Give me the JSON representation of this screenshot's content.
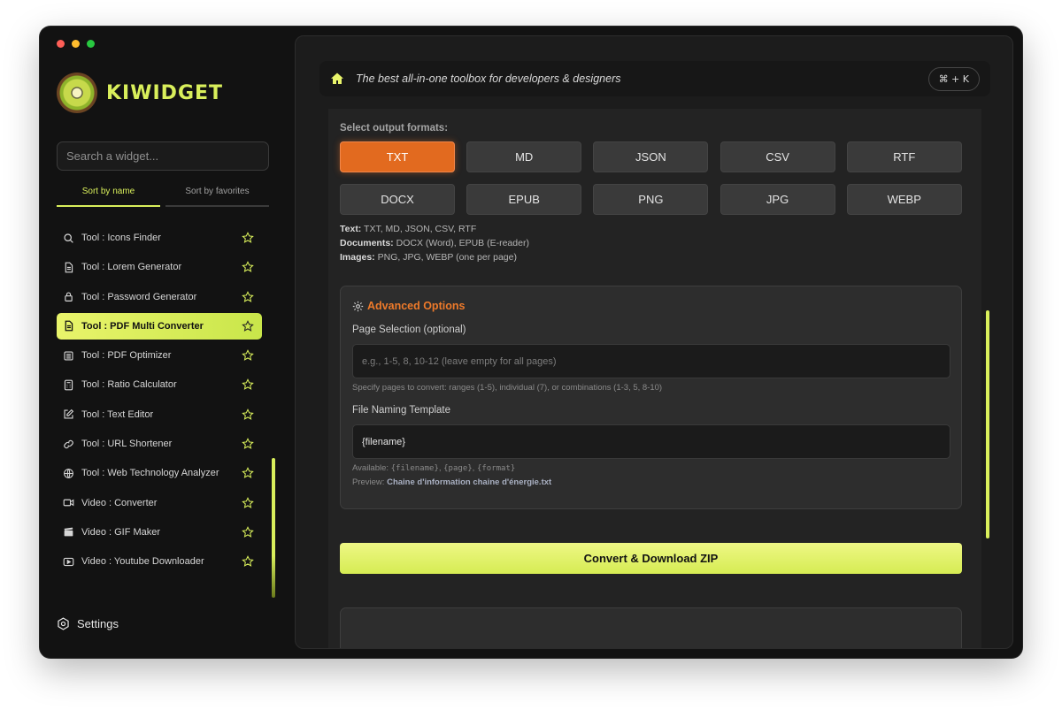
{
  "window": {
    "traffic_lights": [
      "close",
      "minimize",
      "zoom"
    ]
  },
  "brand": {
    "name": "KIWIDGET",
    "logo_icon": "kiwi-logo",
    "accent": "#d9ef5b"
  },
  "sidebar": {
    "search_placeholder": "Search a widget...",
    "sort_tabs": [
      {
        "label": "Sort by name",
        "active": true
      },
      {
        "label": "Sort by favorites",
        "active": false
      }
    ],
    "items": [
      {
        "label": "Tool : Icons Finder",
        "icon": "search-icon",
        "active": false
      },
      {
        "label": "Tool : Lorem Generator",
        "icon": "document-icon",
        "active": false
      },
      {
        "label": "Tool : Password Generator",
        "icon": "lock-icon",
        "active": false
      },
      {
        "label": "Tool : PDF Multi Converter",
        "icon": "file-text-icon",
        "active": true
      },
      {
        "label": "Tool : PDF Optimizer",
        "icon": "archive-icon",
        "active": false
      },
      {
        "label": "Tool : Ratio Calculator",
        "icon": "calculator-icon",
        "active": false
      },
      {
        "label": "Tool : Text Editor",
        "icon": "edit-icon",
        "active": false
      },
      {
        "label": "Tool : URL Shortener",
        "icon": "link-icon",
        "active": false
      },
      {
        "label": "Tool : Web Technology Analyzer",
        "icon": "globe-icon",
        "active": false
      },
      {
        "label": "Video : Converter",
        "icon": "video-icon",
        "active": false
      },
      {
        "label": "Video : GIF Maker",
        "icon": "clapperboard-icon",
        "active": false
      },
      {
        "label": "Video : Youtube Downloader",
        "icon": "play-icon",
        "active": false
      }
    ],
    "settings_label": "Settings"
  },
  "topbar": {
    "tagline": "The best all-in-one toolbox for developers & designers",
    "shortcut": "⌘ + K"
  },
  "formats": {
    "title": "Select output formats:",
    "buttons": [
      {
        "label": "TXT",
        "selected": true
      },
      {
        "label": "MD",
        "selected": false
      },
      {
        "label": "JSON",
        "selected": false
      },
      {
        "label": "CSV",
        "selected": false
      },
      {
        "label": "RTF",
        "selected": false
      },
      {
        "label": "DOCX",
        "selected": false
      },
      {
        "label": "EPUB",
        "selected": false
      },
      {
        "label": "PNG",
        "selected": false
      },
      {
        "label": "JPG",
        "selected": false
      },
      {
        "label": "WEBP",
        "selected": false
      }
    ],
    "info": [
      {
        "label": "Text:",
        "value": "TXT, MD, JSON, CSV, RTF"
      },
      {
        "label": "Documents:",
        "value": "DOCX (Word), EPUB (E-reader)"
      },
      {
        "label": "Images:",
        "value": "PNG, JPG, WEBP (one per page)"
      }
    ],
    "selected_color": "#e26a1f"
  },
  "advanced": {
    "title": "Advanced Options",
    "page_selection": {
      "label": "Page Selection (optional)",
      "placeholder": "e.g., 1-5, 8, 10-12 (leave empty for all pages)",
      "value": "",
      "hint": "Specify pages to convert: ranges (1-5), individual (7), or combinations (1-3, 5, 8-10)"
    },
    "naming": {
      "label": "File Naming Template",
      "value": "{filename}",
      "available_label": "Available:",
      "tokens": [
        "{filename}",
        "{page}",
        "{format}"
      ],
      "preview_label": "Preview:",
      "preview_value": "Chaine d'information chaine d'énergie.txt"
    },
    "title_color": "#ee7a2a"
  },
  "actions": {
    "convert_label": "Convert & Download ZIP"
  }
}
